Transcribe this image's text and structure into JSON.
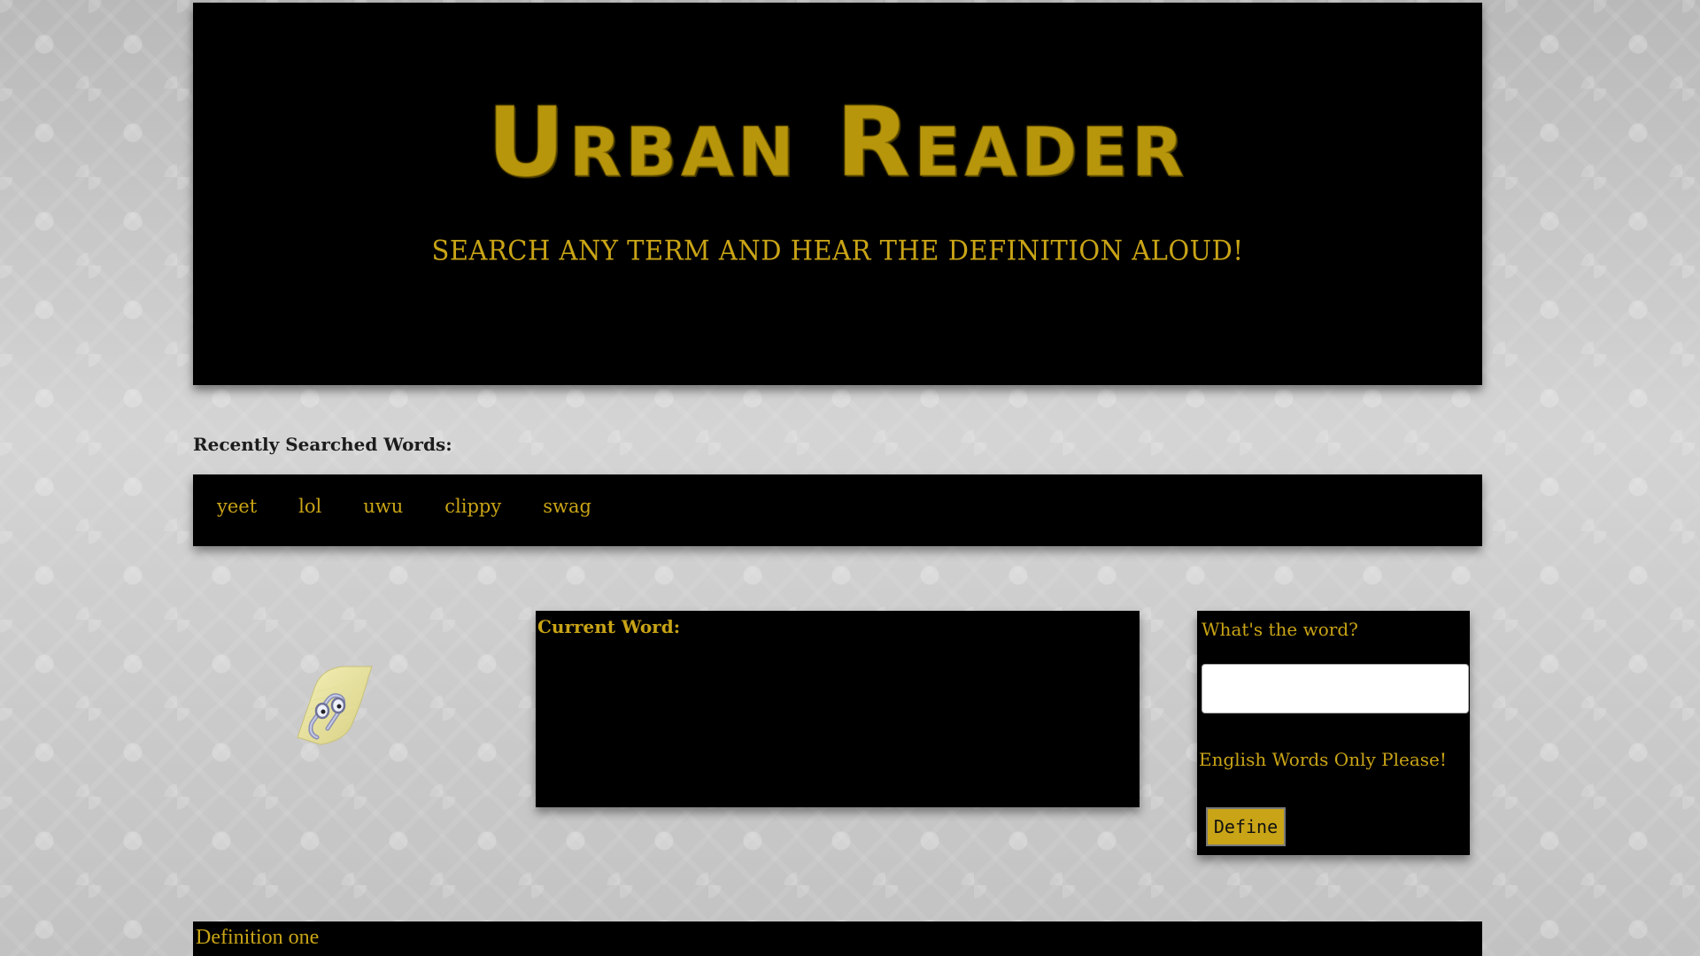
{
  "header": {
    "title": "Urban Reader",
    "tagline": "SEARCH ANY TERM AND HEAR THE DEFINITION ALOUD!"
  },
  "recent": {
    "heading": "Recently Searched Words:",
    "words": [
      "yeet",
      "lol",
      "uwu",
      "clippy",
      "swag"
    ]
  },
  "current": {
    "label": "Current Word:"
  },
  "search": {
    "prompt": "What's the word?",
    "input_value": "",
    "note": "English Words Only Please!",
    "button_label": "Define"
  },
  "definition": {
    "text": "Definition one"
  },
  "colors": {
    "accent_gold": "#c9a416",
    "panel_black": "#000000"
  },
  "icons": {
    "assistant": "clippy-paperclip-icon"
  }
}
